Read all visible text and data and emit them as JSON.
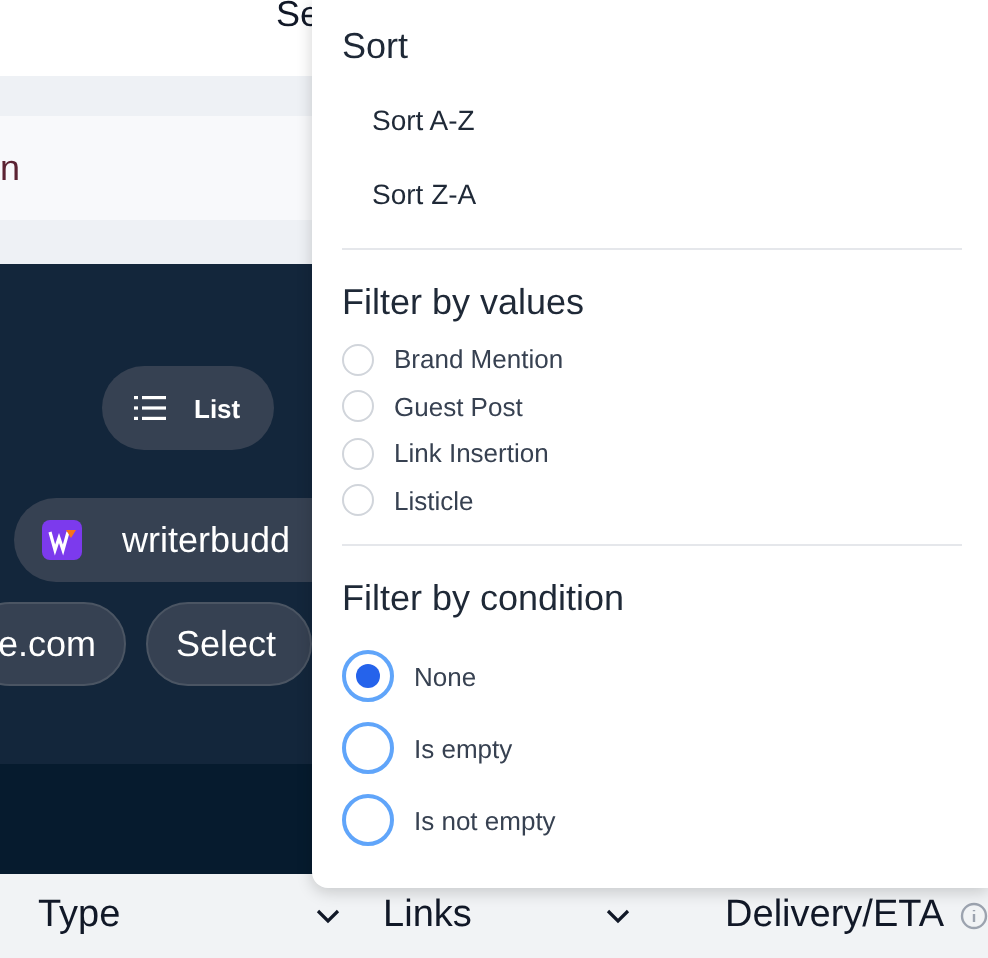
{
  "top_bar": {
    "text": "Se"
  },
  "search": {
    "value": "n"
  },
  "view_toggle": {
    "label": "List"
  },
  "site_chip": {
    "label": "writerbudd"
  },
  "chips": [
    {
      "label": "e.com"
    },
    {
      "label": "Select"
    }
  ],
  "table": {
    "columns": [
      {
        "label": "Type",
        "kind": "dropdown"
      },
      {
        "label": "Links",
        "kind": "dropdown"
      },
      {
        "label": "Delivery/ETA",
        "kind": "info"
      }
    ]
  },
  "menu": {
    "sort": {
      "title": "Sort",
      "options": [
        "Sort A-Z",
        "Sort Z-A"
      ]
    },
    "filter_values": {
      "title": "Filter by values",
      "options": [
        {
          "label": "Brand Mention",
          "selected": false
        },
        {
          "label": "Guest Post",
          "selected": false
        },
        {
          "label": "Link Insertion",
          "selected": false
        },
        {
          "label": "Listicle",
          "selected": false
        }
      ]
    },
    "filter_condition": {
      "title": "Filter by condition",
      "options": [
        {
          "label": "None",
          "selected": true
        },
        {
          "label": "Is empty",
          "selected": false
        },
        {
          "label": "Is not empty",
          "selected": false
        }
      ]
    }
  }
}
